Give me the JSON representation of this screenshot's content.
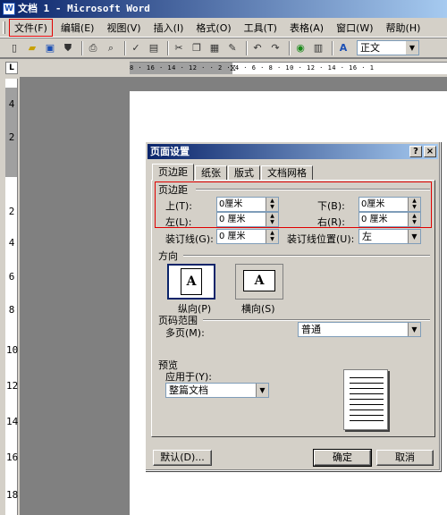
{
  "window": {
    "title": "文档 1 - Microsoft Word",
    "app_icon": "W"
  },
  "menubar": [
    {
      "label": "文件(F)",
      "active": true
    },
    {
      "label": "编辑(E)"
    },
    {
      "label": "视图(V)"
    },
    {
      "label": "插入(I)"
    },
    {
      "label": "格式(O)"
    },
    {
      "label": "工具(T)"
    },
    {
      "label": "表格(A)"
    },
    {
      "label": "窗口(W)"
    },
    {
      "label": "帮助(H)"
    }
  ],
  "toolbar": {
    "style_value": "正文",
    "icons": [
      "new-icon",
      "open-icon",
      "save-icon",
      "permission-icon",
      "print-icon",
      "print-preview-icon",
      "spelling-icon",
      "research-icon",
      "cut-icon",
      "copy-icon",
      "paste-icon",
      "format-painter-icon",
      "undo-icon",
      "redo-icon",
      "hyperlink-icon",
      "tables-icon",
      "styles-icon"
    ]
  },
  "ruler": {
    "corner": "L",
    "horizontal_ticks": "8 · 16 · 14 · 12 ·   · 2 · 4 · 6 · 8 · 10 · 12 · 14 · 16 · 1",
    "vertical_labels": [
      "4",
      "2",
      "2",
      "4",
      "6",
      "8",
      "10",
      "12",
      "14",
      "16",
      "18"
    ]
  },
  "dialog": {
    "title": "页面设置",
    "help_btn": "?",
    "close_btn": "×",
    "tabs": [
      "页边距",
      "纸张",
      "版式",
      "文档网格"
    ],
    "active_tab": 0,
    "margins_group": "页边距",
    "top_label": "上(T):",
    "top_value": "0厘米",
    "bottom_label": "下(B):",
    "bottom_value": "0厘米",
    "left_label": "左(L):",
    "left_value": "0 厘米",
    "right_label": "右(R):",
    "right_value": "0 厘米",
    "gutter_label": "装订线(G):",
    "gutter_value": "0 厘米",
    "gutter_pos_label": "装订线位置(U):",
    "gutter_pos_value": "左",
    "orientation_group": "方向",
    "portrait_label": "纵向(P)",
    "landscape_label": "横向(S)",
    "portrait_glyph": "A",
    "landscape_glyph": "A",
    "pages_group": "页码范围",
    "multiple_pages_label": "多页(M):",
    "multiple_pages_value": "普通",
    "preview_group": "预览",
    "apply_to_label": "应用于(Y):",
    "apply_to_value": "整篇文档",
    "default_btn": "默认(D)...",
    "ok_btn": "确定",
    "cancel_btn": "取消"
  }
}
